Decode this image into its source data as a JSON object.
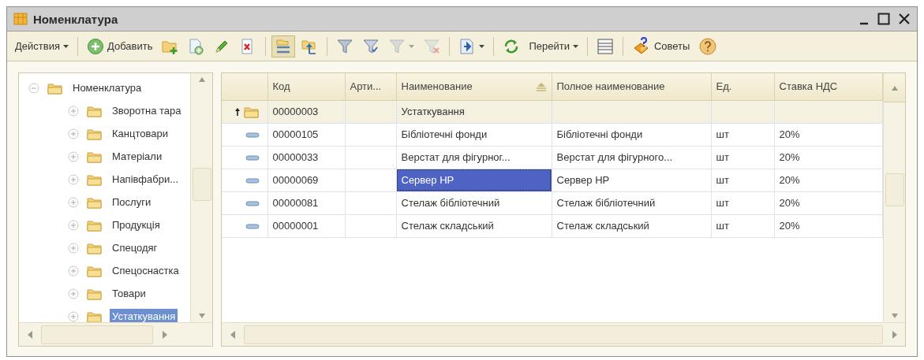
{
  "window": {
    "title": "Номенклатура"
  },
  "toolbar": [
    {
      "kind": "menu",
      "label": "Действия"
    },
    {
      "kind": "separator"
    },
    {
      "kind": "button",
      "label": "Добавить"
    },
    {
      "kind": "icon",
      "pressed": false,
      "disabled": false
    },
    {
      "kind": "icon",
      "pressed": false,
      "disabled": false
    },
    {
      "kind": "icon",
      "pressed": false,
      "disabled": false
    },
    {
      "kind": "icon",
      "pressed": false,
      "disabled": false
    },
    {
      "kind": "separator"
    },
    {
      "kind": "icon",
      "pressed": true,
      "disabled": false
    },
    {
      "kind": "icon",
      "pressed": false,
      "disabled": false
    },
    {
      "kind": "separator"
    },
    {
      "kind": "icon",
      "pressed": false,
      "disabled": false
    },
    {
      "kind": "icon",
      "pressed": false,
      "disabled": false
    },
    {
      "kind": "dropdown",
      "pressed": false,
      "disabled": true
    },
    {
      "kind": "icon",
      "pressed": false,
      "disabled": true
    },
    {
      "kind": "separator"
    },
    {
      "kind": "dropdown",
      "pressed": false,
      "disabled": false
    },
    {
      "kind": "separator"
    },
    {
      "kind": "icon",
      "pressed": false,
      "disabled": false
    },
    {
      "kind": "menu",
      "label": "Перейти"
    },
    {
      "kind": "separator"
    },
    {
      "kind": "icon",
      "pressed": false,
      "disabled": false
    },
    {
      "kind": "separator"
    },
    {
      "kind": "button",
      "label": "Советы"
    },
    {
      "kind": "icon",
      "pressed": false,
      "disabled": false
    }
  ],
  "tree": [
    {
      "label": "Номенклатура",
      "expanded": true,
      "selected": false,
      "children": [
        {
          "label": "Зворотна тара",
          "expanded": false,
          "selected": false
        },
        {
          "label": "Канцтовари",
          "expanded": false,
          "selected": false
        },
        {
          "label": "Матеріали",
          "expanded": false,
          "selected": false
        },
        {
          "label": "Напівфабри...",
          "expanded": false,
          "selected": false
        },
        {
          "label": "Послуги",
          "expanded": false,
          "selected": false
        },
        {
          "label": "Продукція",
          "expanded": false,
          "selected": false
        },
        {
          "label": "Спецодяг",
          "expanded": false,
          "selected": false
        },
        {
          "label": "Спецоснастка",
          "expanded": false,
          "selected": false
        },
        {
          "label": "Товари",
          "expanded": false,
          "selected": false
        },
        {
          "label": "Устаткування",
          "expanded": false,
          "selected": true
        }
      ]
    }
  ],
  "table": {
    "columns": [
      {
        "label": "Код",
        "sorted": false
      },
      {
        "label": "Арти...",
        "sorted": false
      },
      {
        "label": "Наименование",
        "sorted": true
      },
      {
        "label": "Полное наименование",
        "sorted": false
      },
      {
        "label": "Ед.",
        "sorted": false
      },
      {
        "label": "Ставка НДС",
        "sorted": false
      }
    ],
    "rows": [
      {
        "kind": "group",
        "selected": false,
        "cells": [
          "00000003",
          "",
          "Устаткування",
          "",
          "",
          ""
        ]
      },
      {
        "kind": "item",
        "selected": false,
        "cells": [
          "00000105",
          "",
          "Бібліотечні фонди",
          "Бібліотечні фонди",
          "шт",
          "20%"
        ]
      },
      {
        "kind": "item",
        "selected": false,
        "cells": [
          "00000033",
          "",
          "Верстат для фігурног...",
          "Верстат для фігурного...",
          "шт",
          "20%"
        ]
      },
      {
        "kind": "item",
        "selected": true,
        "cells": [
          "00000069",
          "",
          "Сервер HP",
          "Сервер HP",
          "шт",
          "20%"
        ]
      },
      {
        "kind": "item",
        "selected": false,
        "cells": [
          "00000081",
          "",
          "Стелаж бібліотечний",
          "Стелаж бібліотечний",
          "шт",
          "20%"
        ]
      },
      {
        "kind": "item",
        "selected": false,
        "cells": [
          "00000001",
          "",
          "Стелаж складський",
          "Стелаж складський",
          "шт",
          "20%"
        ]
      }
    ]
  }
}
